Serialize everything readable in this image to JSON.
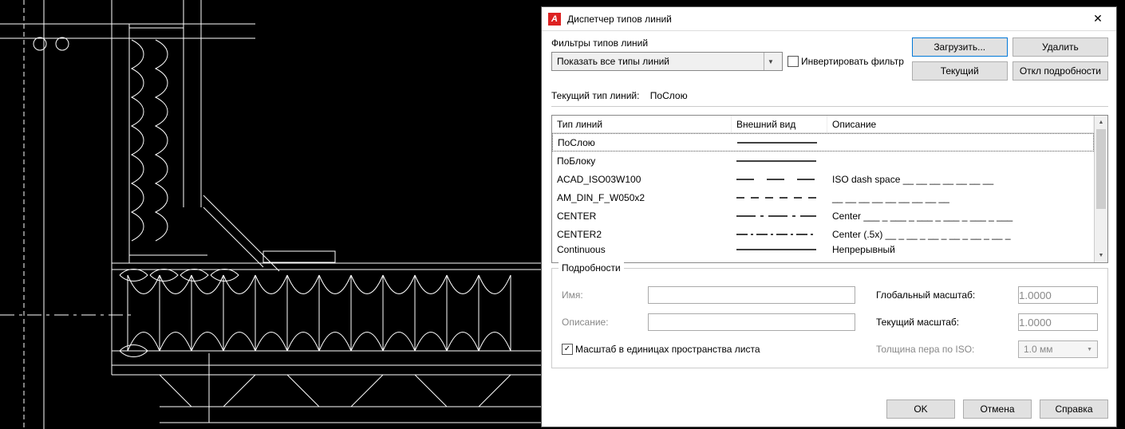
{
  "dialog": {
    "title": "Диспетчер типов линий",
    "app_icon_text": "A",
    "filters_label": "Фильтры типов линий",
    "filter_selected": "Показать все типы линий",
    "invert_label": "Инвертировать фильтр",
    "buttons": {
      "load": "Загрузить...",
      "delete": "Удалить",
      "current": "Текущий",
      "details_off": "Откл подробности"
    },
    "current_linetype_label": "Текущий тип линий:",
    "current_linetype_value": "ПоСлою",
    "list": {
      "headers": {
        "name": "Тип линий",
        "appearance": "Внешний вид",
        "description": "Описание"
      },
      "rows": [
        {
          "name": "ПоСлою",
          "desc": "",
          "style": "solid",
          "selected": true
        },
        {
          "name": "ПоБлоку",
          "desc": "",
          "style": "solid"
        },
        {
          "name": "ACAD_ISO03W100",
          "desc": "ISO dash space __ __ __ __ __ __ __",
          "style": "longspace"
        },
        {
          "name": "AM_DIN_F_W050x2",
          "desc": "__ __ __ __ __ __ __ __ __",
          "style": "shortdash"
        },
        {
          "name": "CENTER",
          "desc": "Center ___ _ ___ _ ___ _ ___ _ ___ _ ___",
          "style": "center"
        },
        {
          "name": "CENTER2",
          "desc": "Center (.5x) __ _ __ _ __ _ __ _ __ _ __ _",
          "style": "center2"
        },
        {
          "name": "Continuous",
          "desc": "Непрерывный",
          "style": "solid",
          "truncated": true
        }
      ]
    },
    "details": {
      "legend": "Подробности",
      "name_label": "Имя:",
      "desc_label": "Описание:",
      "paperspace_units_label": "Масштаб в единицах пространства листа",
      "paperspace_units_checked": true,
      "global_scale_label": "Глобальный масштаб:",
      "global_scale_value": "1.0000",
      "current_scale_label": "Текущий масштаб:",
      "current_scale_value": "1.0000",
      "iso_pen_label": "Толщина пера по ISO:",
      "iso_pen_value": "1.0 мм"
    },
    "bottom": {
      "ok": "OK",
      "cancel": "Отмена",
      "help": "Справка"
    }
  }
}
